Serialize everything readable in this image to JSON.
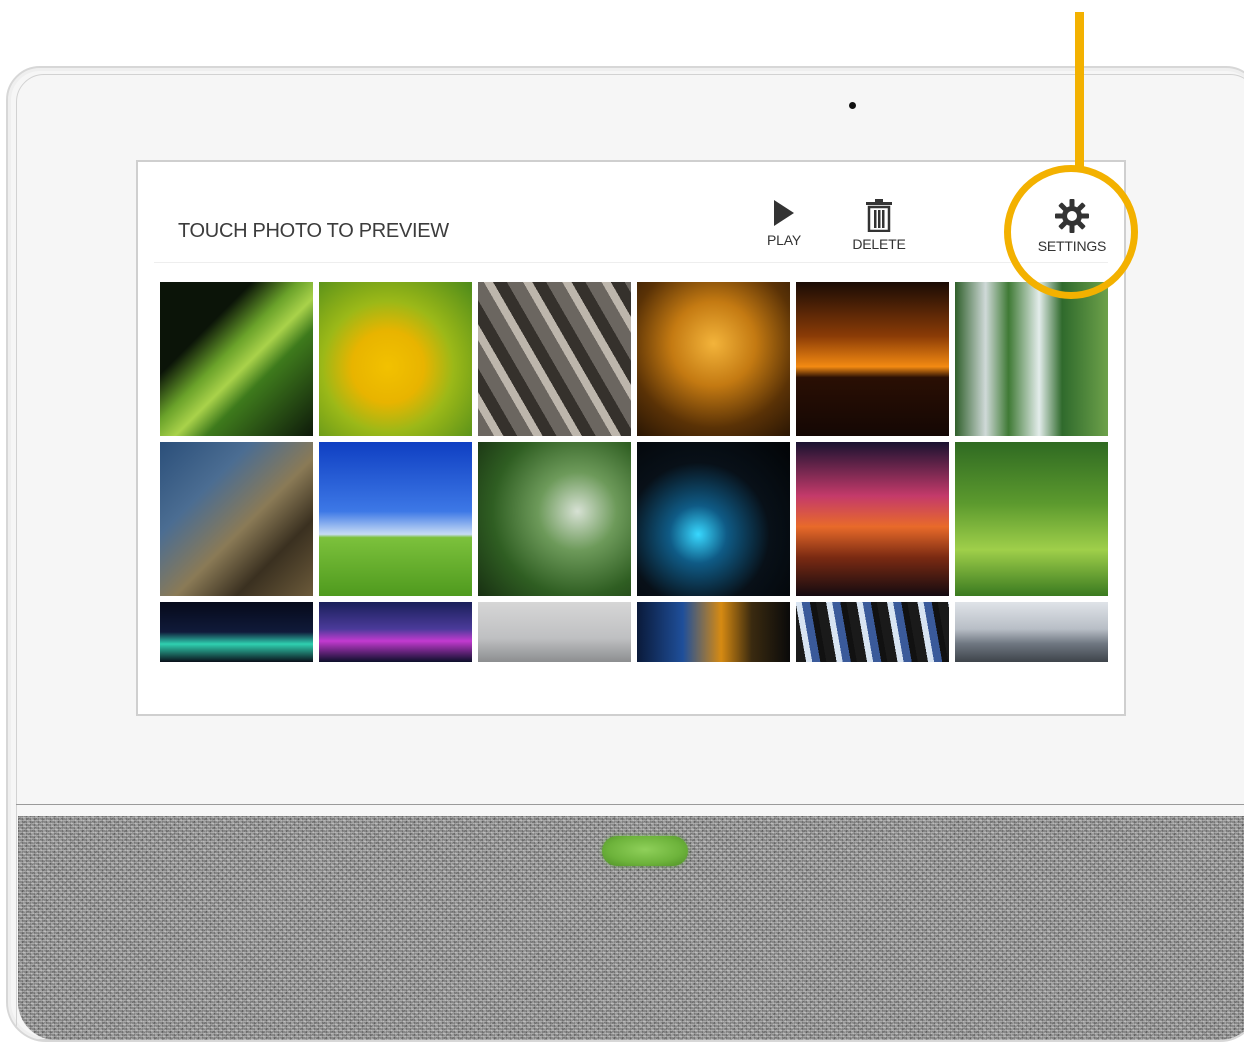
{
  "screen": {
    "title": "TOUCH PHOTO TO PREVIEW",
    "toolbar": {
      "play_label": "PLAY",
      "delete_label": "DELETE",
      "settings_label": "SETTINGS"
    }
  },
  "photos": [
    {
      "name": "photo-leaf-droplets",
      "bg": "linear-gradient(135deg,#0b1408 0%,#0b1408 30%,#6aa22a 45%,#a9d24a 55%,#3e7a1c 65%,#0e1a0a 100%)"
    },
    {
      "name": "photo-butterfly-flower",
      "bg": "radial-gradient(circle at 45% 55%,#f2c100 0%,#e8b400 30%,#9bb818 55%,#4d8a1a 100%)"
    },
    {
      "name": "photo-water-drops",
      "bg": "repeating-linear-gradient(60deg,#6b6660 0 14px,#bdb6ac 14px 22px,#35312c 22px 34px)"
    },
    {
      "name": "photo-autumn-forest",
      "bg": "radial-gradient(circle at 50% 40%,#f3b43b 0%,#c47a12 35%,#5a3206 70%,#2a1604 100%)"
    },
    {
      "name": "photo-palm-sunset",
      "bg": "linear-gradient(180deg,#1a0b05 0%,#8a3b06 35%,#f38a12 55%,#2a0f04 62%,#140704 100%)"
    },
    {
      "name": "photo-waterfall",
      "bg": "linear-gradient(90deg,#2f5f2a 0%,#cfd9d8 20%,#3f7a35 35%,#e3eceb 55%,#2f6a2c 70%,#6da14a 100%)"
    },
    {
      "name": "photo-canyon-tunnel",
      "bg": "linear-gradient(135deg,#2b4f7a 0%,#4b6d92 30%,#8a7a56 55%,#3a3020 75%,#6b5a3a 100%)"
    },
    {
      "name": "photo-lone-tree",
      "bg": "linear-gradient(180deg,#0f3fc2 0%,#3d78e6 45%,#c7dcf5 60%,#7cc13c 62%,#4f9a1e 100%)"
    },
    {
      "name": "photo-rainforest",
      "bg": "radial-gradient(circle at 65% 45%,#d7e1d4 0%,#6d9a5a 30%,#2f5e22 65%,#183012 100%)"
    },
    {
      "name": "photo-light-trails",
      "bg": "radial-gradient(ellipse at 40% 60%,#38d8ff 0%,#0f5b86 22%,#081018 55%,#020406 100%)"
    },
    {
      "name": "photo-bridge-fireworks",
      "bg": "linear-gradient(180deg,#1a1230 0%,#c43a6a 35%,#e86a2a 55%,#7a2a12 75%,#140a10 100%)"
    },
    {
      "name": "photo-river-forest",
      "bg": "linear-gradient(180deg,#2f6a22 0%,#5c9a2e 40%,#9fcf4a 70%,#3a7a20 100%)"
    },
    {
      "name": "photo-night-bridge",
      "bg": "linear-gradient(180deg,#060a1a 0%,#101a3a 50%,#2fd0b0 70%,#0a0f1a 100%)"
    },
    {
      "name": "photo-city-skyline-night",
      "bg": "linear-gradient(180deg,#1a1f5a 0%,#4b3a9a 45%,#c23ad0 65%,#0c0f2a 100%)"
    },
    {
      "name": "photo-foggy-bridge",
      "bg": "linear-gradient(180deg,#d6d6d6 0%,#bfc0c2 60%,#8c8e90 100%)"
    },
    {
      "name": "photo-city-lights",
      "bg": "linear-gradient(90deg,#0a1a3a 0%,#1f4f9a 30%,#d68a12 55%,#3a2a10 75%,#0a0a0a 100%)"
    },
    {
      "name": "photo-neon-buildings",
      "bg": "repeating-linear-gradient(80deg,#1a1a1a 0 10px,#d8e4f2 10px 16px,#3a5a9a 16px 24px,#111 24px 30px)"
    },
    {
      "name": "photo-city-aerial",
      "bg": "linear-gradient(180deg,#dfe3e8 0%,#b8bec6 45%,#6e7680 70%,#3e444a 100%)"
    }
  ]
}
